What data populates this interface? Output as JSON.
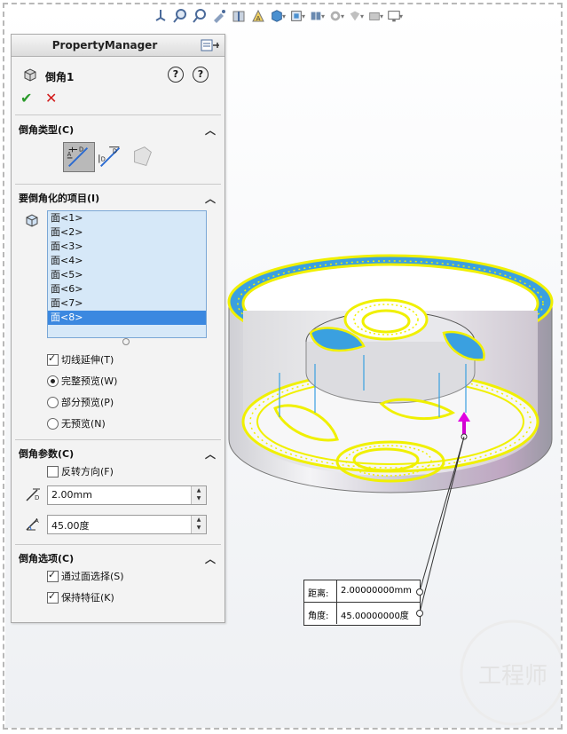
{
  "toolbar": {
    "icons": [
      "view-orientation-icon",
      "zoom-fit-icon",
      "zoom-area-icon",
      "previous-view-icon",
      "section-view-icon",
      "dynamic-annotation-icon",
      "view-cube-icon",
      "display-style-icon",
      "hide-show-icon",
      "edit-appearance-icon",
      "apply-scene-icon",
      "view-settings-icon",
      "monitor-icon"
    ]
  },
  "pm": {
    "header_title": "PropertyManager",
    "feature_name": "倒角1",
    "help1": "?",
    "help2": "?",
    "ok_symbol": "✔",
    "cancel_symbol": "✕"
  },
  "chamfer_type": {
    "title": "倒角类型(C)"
  },
  "items": {
    "title": "要倒角化的项目(I)",
    "faces": [
      "面<1>",
      "面<2>",
      "面<3>",
      "面<4>",
      "面<5>",
      "面<6>",
      "面<7>",
      "面<8>"
    ],
    "selected_index": 7,
    "tangent_propagation": "切线延伸(T)",
    "full_preview": "完整预览(W)",
    "partial_preview": "部分预览(P)",
    "no_preview": "无预览(N)"
  },
  "params": {
    "title": "倒角参数(C)",
    "reverse_direction": "反转方向(F)",
    "distance_value": "2.00mm",
    "angle_value": "45.00度"
  },
  "options": {
    "title": "倒角选项(C)",
    "select_through_faces": "通过面选择(S)",
    "keep_features": "保持特征(K)"
  },
  "callout": {
    "distance_label": "距离:",
    "distance_value": "2.00000000mm",
    "angle_label": "角度:",
    "angle_value": "45.00000000度"
  },
  "watermark": {
    "text": "工程师"
  },
  "colors": {
    "selected_edge": "#f0f000",
    "face_highlight": "#3aa0e0",
    "list_selected": "#3b88e0",
    "ok_green": "#2a9a2a",
    "cancel_red": "#d21a1a"
  }
}
